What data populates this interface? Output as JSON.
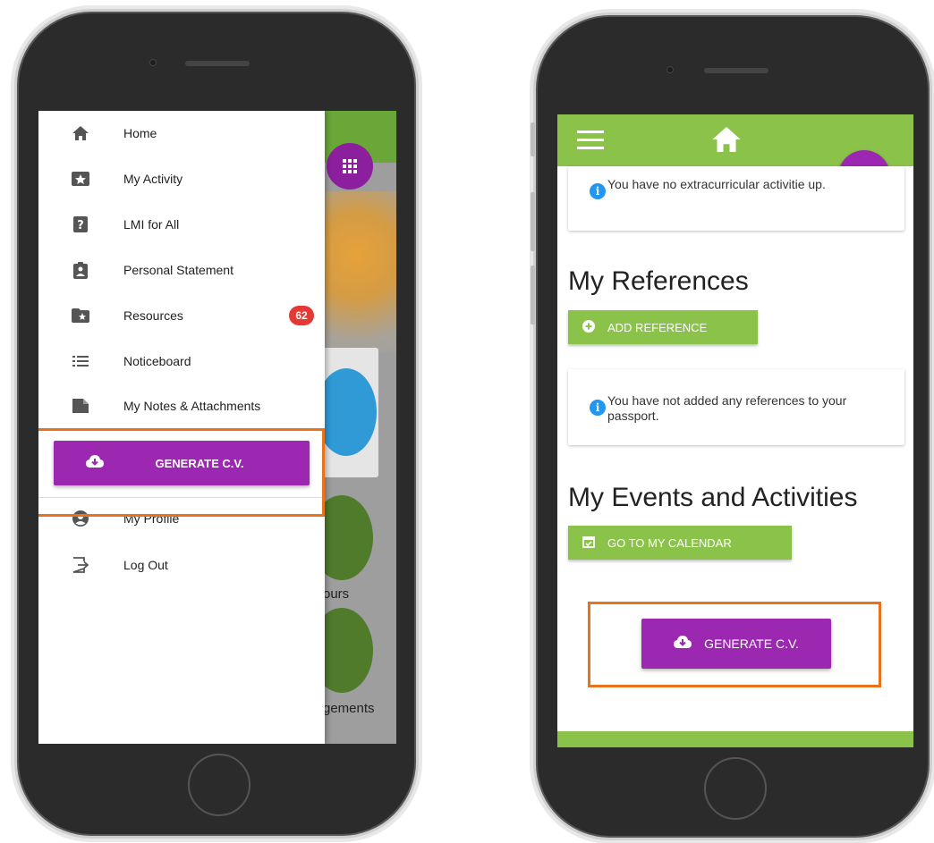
{
  "left_phone": {
    "drawer": {
      "items": [
        {
          "label": "Home",
          "icon": "home-icon"
        },
        {
          "label": "My Activity",
          "icon": "star-activity-icon"
        },
        {
          "label": "LMI for All",
          "icon": "help-icon"
        },
        {
          "label": "Personal Statement",
          "icon": "clipboard-user-icon"
        },
        {
          "label": "Resources",
          "icon": "folder-star-icon",
          "badge": "62"
        },
        {
          "label": "Noticeboard",
          "icon": "list-icon"
        },
        {
          "label": "My Notes & Attachments",
          "icon": "note-icon"
        }
      ],
      "generate_button": "GENERATE C.V.",
      "bottom_items": [
        {
          "label": "My Profile",
          "icon": "account-icon"
        },
        {
          "label": "Log Out",
          "icon": "logout-icon"
        }
      ]
    },
    "background": {
      "text1": "ours",
      "text2": "gements"
    }
  },
  "right_phone": {
    "info_extracurricular": "You have no extracurricular activitie up.",
    "references_title": "My References",
    "add_reference": "ADD REFERENCE",
    "info_references": "You have not added any references to your passport.",
    "events_title": "My Events and Activities",
    "go_calendar": "GO TO MY CALENDAR",
    "generate_button": "GENERATE C.V."
  },
  "colors": {
    "accent_purple": "#9c27b0",
    "accent_green": "#8bc34a",
    "highlight_orange": "#e8731c",
    "badge_red": "#e53935"
  }
}
